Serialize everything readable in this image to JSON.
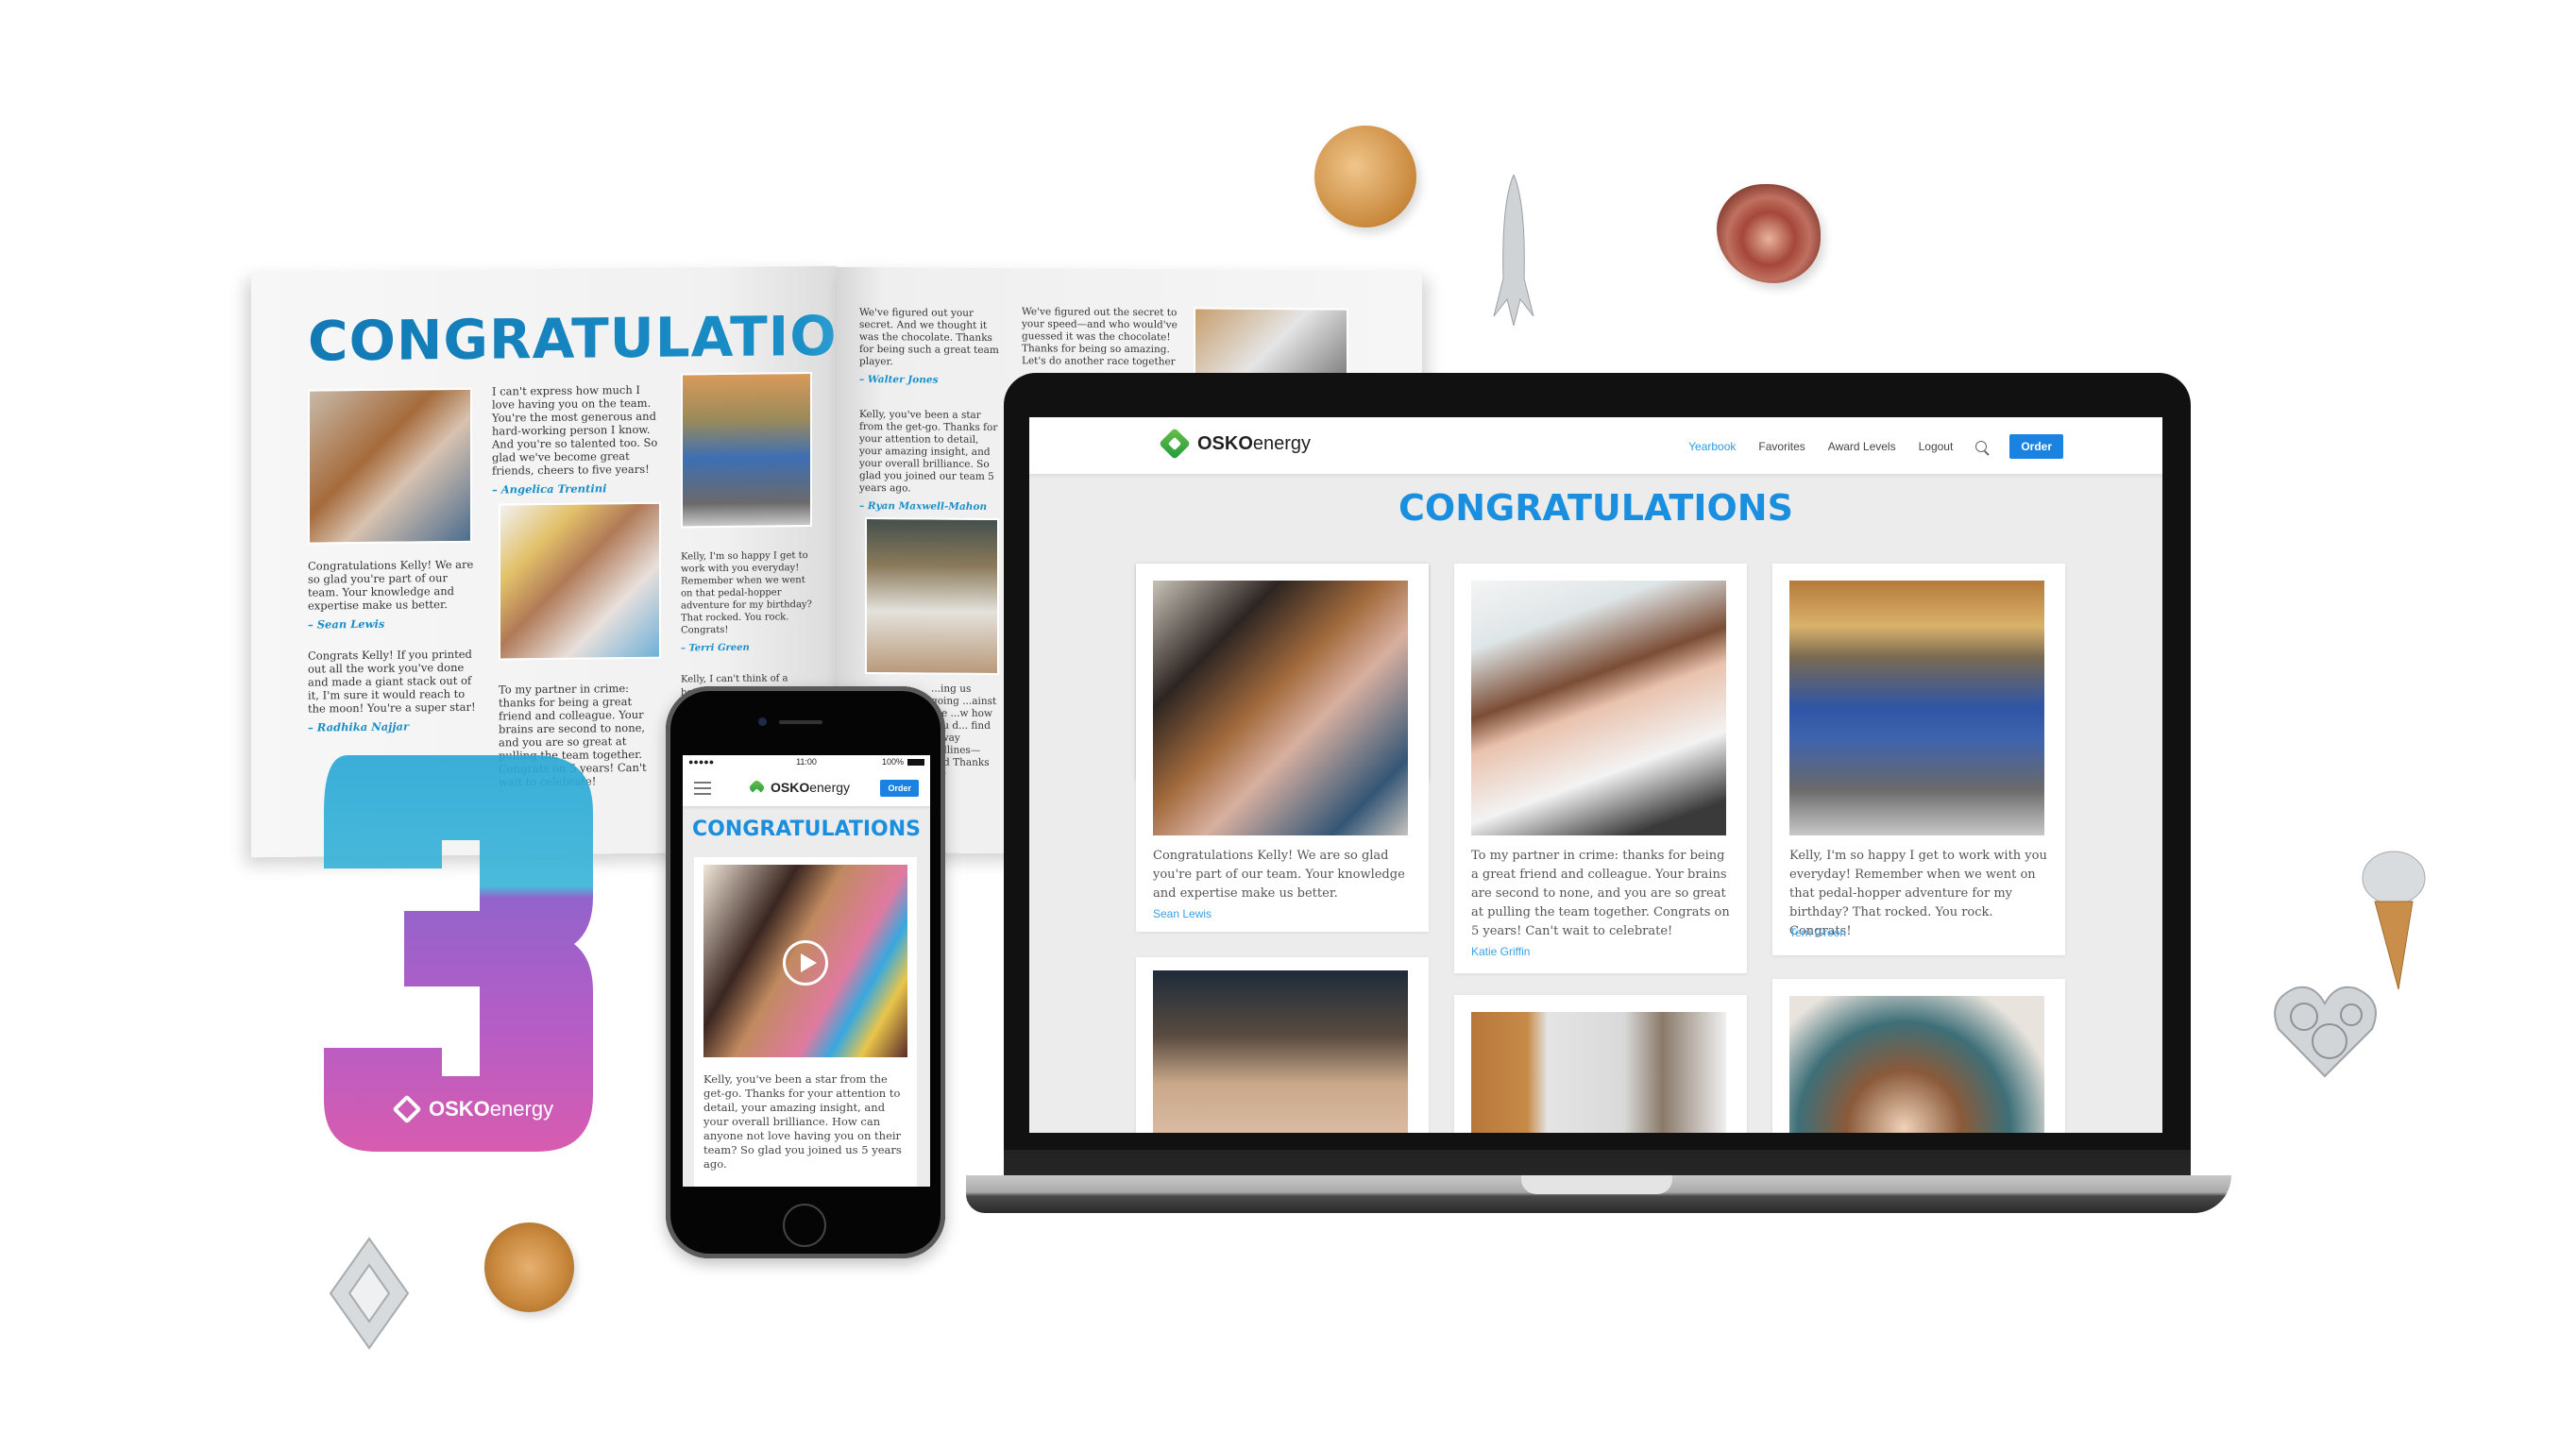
{
  "brand": {
    "name_bold": "OSKO",
    "name_light": "energy",
    "accent": "#1a8fe0",
    "green": "#3cae48",
    "sig_blue": "#3aa0e8"
  },
  "magazine": {
    "title": "CONGRATULATIONS",
    "left_page": [
      {
        "text": "I can't express how much I love having you on the team. You're the most generous and hard-working person I know. And you're so talented too. So glad we've become great friends, cheers to five years!",
        "signature": "– Angelica Trentini"
      },
      {
        "text": "Congratulations Kelly! We are so glad you're part of our team. Your knowledge and expertise make us better.",
        "signature": "– Sean Lewis"
      },
      {
        "text": "Congrats Kelly! If you printed out all the work you've done and made a giant stack out of it, I'm sure it would reach to the moon! You're a super star!",
        "signature": "– Radhika Najjar"
      },
      {
        "text": "To my partner in crime: thanks for being a great friend and colleague. Your brains are second to none, and you are so great at pulling the team together. Congrats on 5 years! Can't wait to celebrate!",
        "signature": ""
      },
      {
        "text": "Kelly, I'm so happy I get to work with you everyday! Remember when we went on that pedal-hopper adventure for my birthday? That rocked. You rock. Congrats!",
        "signature": "– Terri Green"
      },
      {
        "text": "Kelly, I can't think of a better rea...",
        "signature": ""
      }
    ],
    "right_page": [
      {
        "text": "We've figured out your secret. And we thought it was the chocolate. Thanks for being such a great team player.",
        "signature": "– Walter Jones"
      },
      {
        "text": "We've figured out the secret to your speed—and who would've guessed it was the chocolate! Thanks for being so amazing. Let's do another race together",
        "signature": ""
      },
      {
        "text": "Kelly, you've been a star from the get-go. Thanks for your attention to detail, your amazing insight, and your overall brilliance. So glad you joined our team 5 years ago.",
        "signature": "– Ryan Maxwell-Mahon"
      },
      {
        "text": "...ing us going ...ainst the ...w how you d... find a way ...dlines—and Thanks for",
        "signature": ""
      }
    ]
  },
  "award": {
    "number": "3",
    "brand_bold": "OSKO",
    "brand_light": "energy"
  },
  "laptop": {
    "nav": {
      "items": [
        {
          "label": "Yearbook",
          "active": true
        },
        {
          "label": "Favorites"
        },
        {
          "label": "Award Levels"
        },
        {
          "label": "Logout"
        }
      ],
      "order_label": "Order",
      "search_icon": "search-icon"
    },
    "title": "CONGRATULATIONS",
    "cards": [
      {
        "text": "Congratulations Kelly! We are so glad you're part of our team. Your knowledge and expertise make us better.",
        "signature": "Sean Lewis",
        "photo": "group-selfie-thumbs-up"
      },
      {
        "text": "To my partner in crime: thanks for being a great friend and colleague. Your brains are second to none, and you are so great at pulling the team together. Congrats on 5 years! Can't wait to celebrate!",
        "signature": "Katie Griffin",
        "photo": "woman-with-dog-selfie"
      },
      {
        "text": "Kelly, I'm so happy I get to work with you everyday! Remember when we went on that pedal-hopper adventure for my birthday? That rocked. You rock. Congrats!",
        "signature": "Terri Green",
        "photo": "pedal-bike-group"
      },
      {
        "photo": "woman-glasses-cafe"
      },
      {
        "photo": "woman-glasses-office"
      },
      {
        "photo": "friends-circle-looking-down"
      }
    ]
  },
  "phone": {
    "status": {
      "carrier": "●●●●● ",
      "time": "11:00",
      "battery": "100%"
    },
    "order_label": "Order",
    "title": "CONGRATULATIONS",
    "card": {
      "text": "Kelly, you've been a star from the get-go. Thanks for your attention to detail, your amazing insight, and your overall brilliance. How can anyone not love having you on their team? So glad you joined us 5 years ago.",
      "media": "video"
    }
  },
  "trinkets": [
    "globe-pin",
    "rocket-pin",
    "rose-pin",
    "ice-cream-pin",
    "gear-heart-pin",
    "diamond-pin",
    "compass-pin"
  ]
}
